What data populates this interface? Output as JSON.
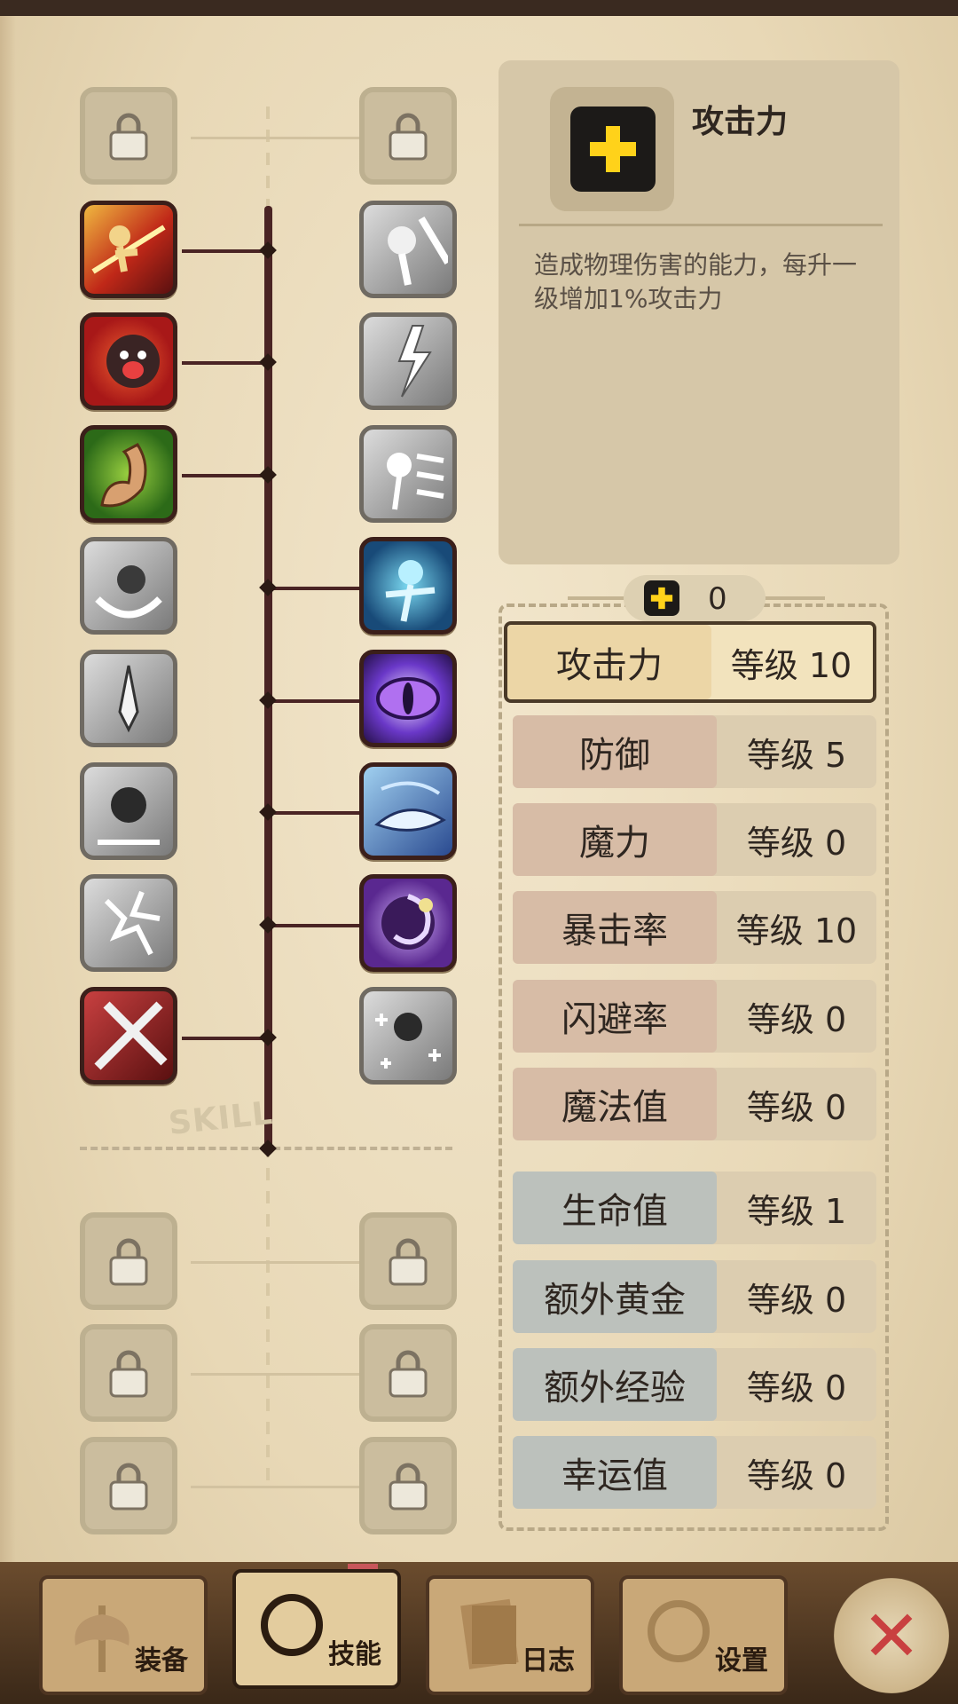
{
  "skill_tree": {
    "watermark": "SKILL"
  },
  "info": {
    "title": "攻击力",
    "description": "造成物理伤害的能力，每升一级增加1%攻击力",
    "icon": "plus-icon"
  },
  "points": {
    "value": "0",
    "icon": "plus-icon"
  },
  "stats": [
    {
      "name": "攻击力",
      "level": "等级 10",
      "group": "red",
      "selected": true
    },
    {
      "name": "防御",
      "level": "等级 5",
      "group": "red"
    },
    {
      "name": "魔力",
      "level": "等级 0",
      "group": "red"
    },
    {
      "name": "暴击率",
      "level": "等级 10",
      "group": "red"
    },
    {
      "name": "闪避率",
      "level": "等级 0",
      "group": "red"
    },
    {
      "name": "魔法值",
      "level": "等级 0",
      "group": "red"
    },
    {
      "name": "生命值",
      "level": "等级 1",
      "group": "blue"
    },
    {
      "name": "额外黄金",
      "level": "等级 0",
      "group": "blue"
    },
    {
      "name": "额外经验",
      "level": "等级 0",
      "group": "blue"
    },
    {
      "name": "幸运值",
      "level": "等级 0",
      "group": "blue"
    }
  ],
  "tabs": [
    {
      "label": "装备",
      "icon": "axe-icon"
    },
    {
      "label": "技能",
      "icon": "skill-ring-icon",
      "active": true
    },
    {
      "label": "日志",
      "icon": "journal-icon"
    },
    {
      "label": "设置",
      "icon": "gear-icon"
    }
  ],
  "close": {
    "label": "✕",
    "icon": "close-icon"
  },
  "colors": {
    "accent": "#ffd21a",
    "trunk": "#4a2424"
  }
}
